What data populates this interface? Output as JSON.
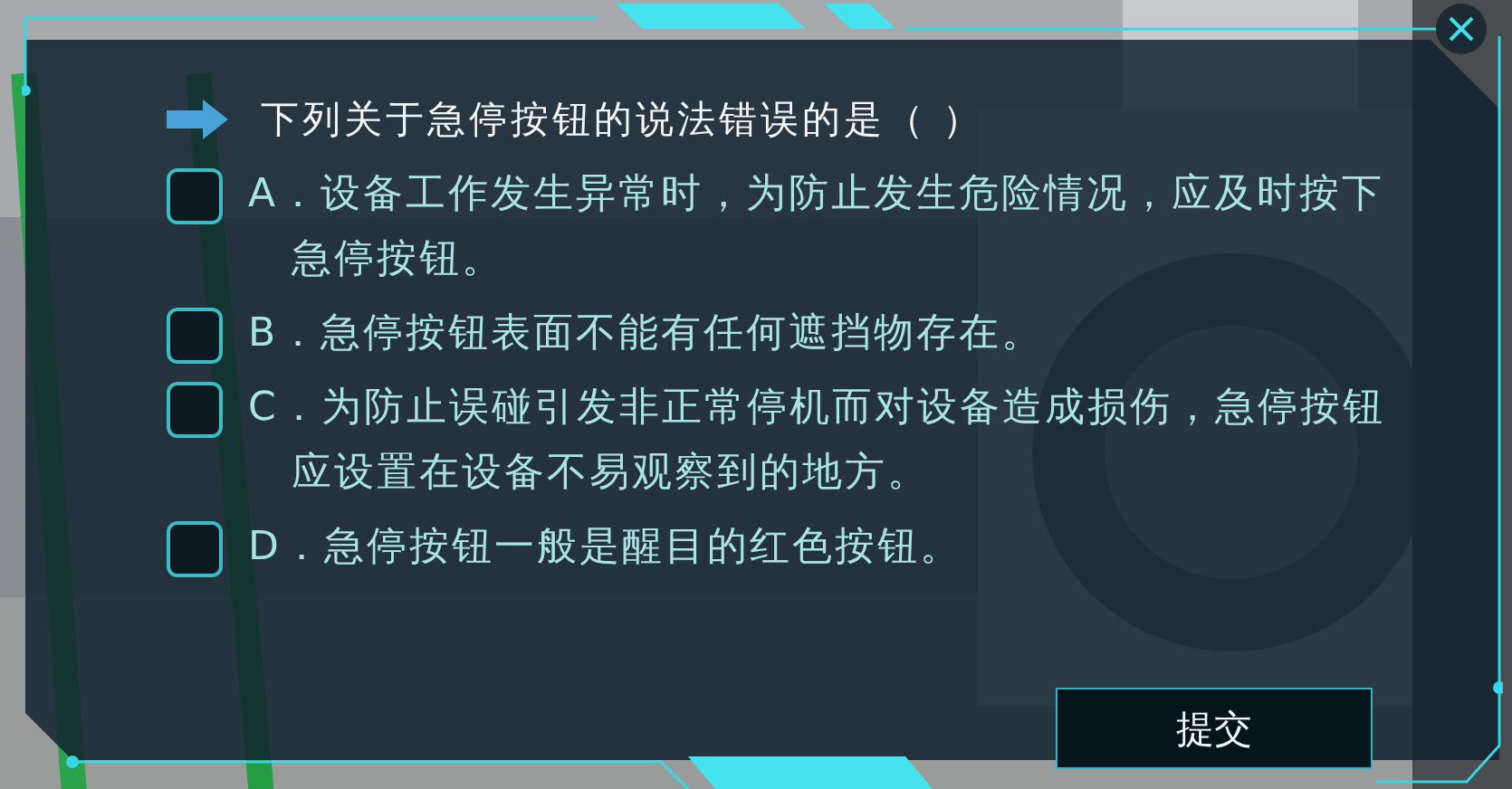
{
  "question": {
    "text": "下列关于急停按钮的说法错误的是（  ）"
  },
  "options": [
    {
      "text": "A．设备工作发生异常时，为防止发生危险情况，应及时按下急停按钮。",
      "checked": false
    },
    {
      "text": "B．急停按钮表面不能有任何遮挡物存在。",
      "checked": false
    },
    {
      "text": "C．为防止误碰引发非正常停机而对设备造成损伤，急停按钮应设置在设备不易观察到的地方。",
      "checked": false
    },
    {
      "text": "D．急停按钮一般是醒目的红色按钮。",
      "checked": false
    }
  ],
  "submit_button": {
    "label": "提交"
  }
}
